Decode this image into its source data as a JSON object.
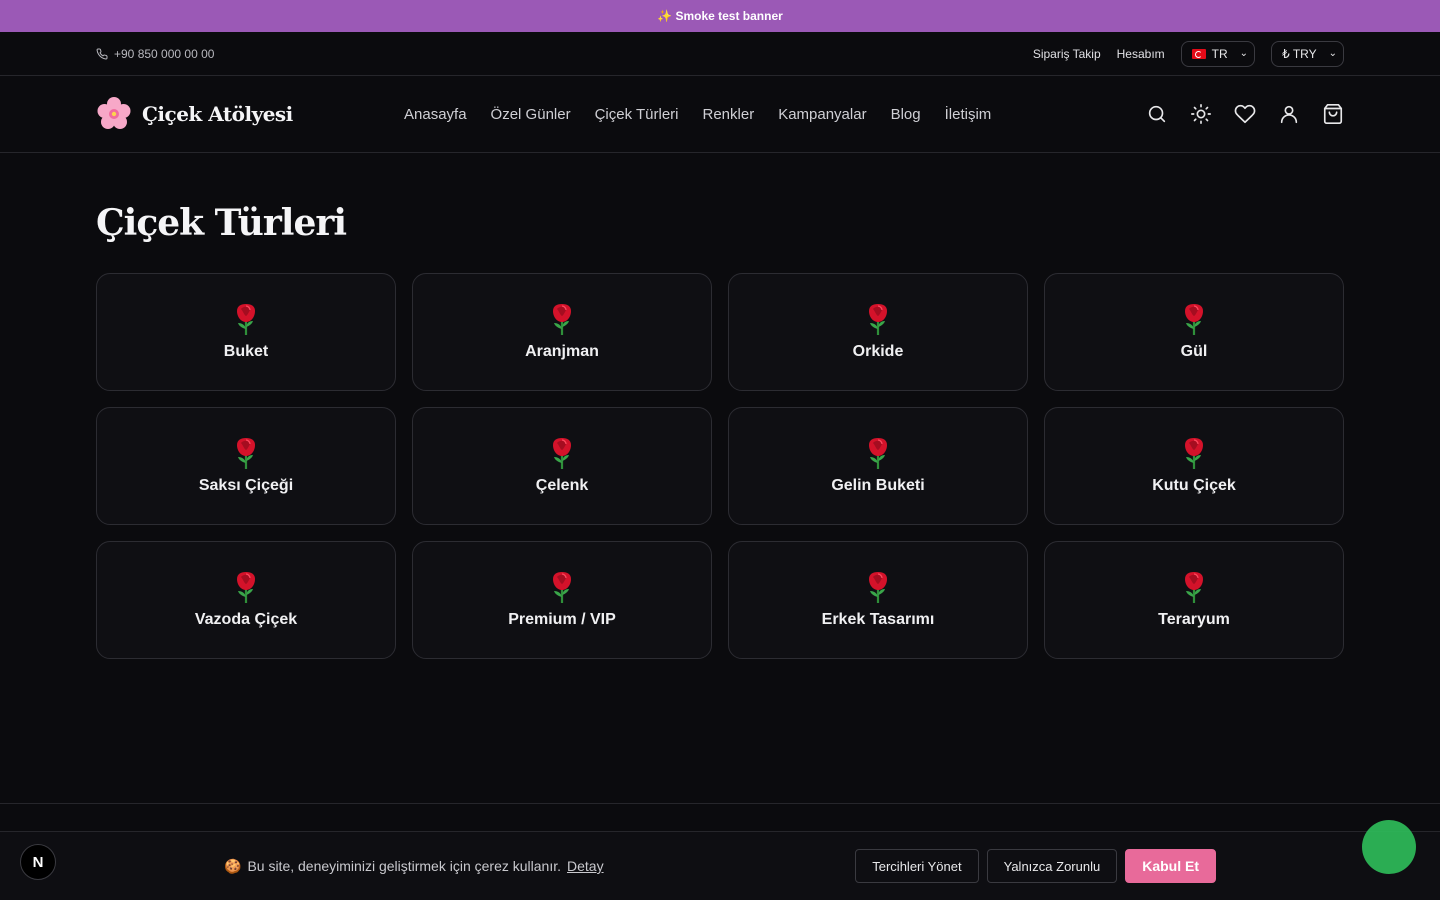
{
  "promo_banner": {
    "text": "✨ Smoke test banner"
  },
  "topbar": {
    "phone": "+90 850 000 00 00",
    "order_tracking": "Sipariş Takip",
    "account": "Hesabım",
    "language": "TR",
    "currency": "₺ TRY"
  },
  "header": {
    "brand": "Çiçek Atölyesi",
    "nav": [
      "Anasayfa",
      "Özel Günler",
      "Çiçek Türleri",
      "Renkler",
      "Kampanyalar",
      "Blog",
      "İletişim"
    ]
  },
  "main": {
    "title": "Çiçek Türleri",
    "categories": [
      "Buket",
      "Aranjman",
      "Orkide",
      "Gül",
      "Saksı Çiçeği",
      "Çelenk",
      "Gelin Buketi",
      "Kutu Çiçek",
      "Vazoda Çiçek",
      "Premium / VIP",
      "Erkek Tasarımı",
      "Teraryum"
    ]
  },
  "cookie_banner": {
    "message": "Bu site, deneyiminizi geliştirmek için çerez kullanır.",
    "detail_link": "Detay",
    "manage_button": "Tercihleri Yönet",
    "necessary_button": "Yalnızca Zorunlu",
    "accept_button": "Kabul Et"
  },
  "dev_badge": "N",
  "colors": {
    "accent": "#e86a9a",
    "promo": "#9b59b6",
    "background": "#0b0b0e",
    "chat": "#2fbf5b"
  }
}
